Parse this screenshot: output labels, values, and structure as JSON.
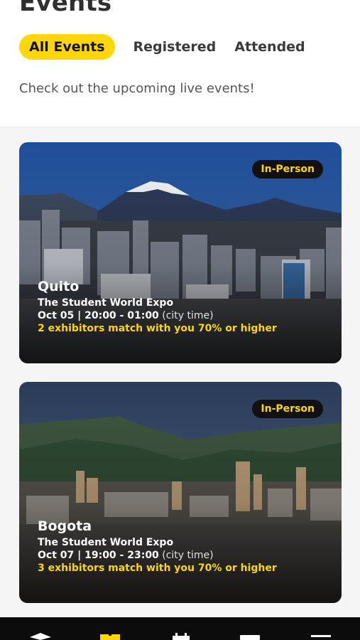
{
  "header": {
    "title": "Events",
    "tabs": [
      {
        "label": "All Events",
        "active": true
      },
      {
        "label": "Registered",
        "active": false
      },
      {
        "label": "Attended",
        "active": false
      }
    ],
    "subtitle": "Check out the upcoming live events!"
  },
  "events": [
    {
      "badge": "In-Person",
      "city": "Quito",
      "name": "The Student World Expo",
      "datetime": "Oct 05 | 20:00 - 01:00",
      "timezone_note": "(city time)",
      "match": "2 exhibitors match with you 70% or higher"
    },
    {
      "badge": "In-Person",
      "city": "Bogota",
      "name": "The Student World Expo",
      "datetime": "Oct 07 | 19:00 - 23:00",
      "timezone_note": "(city time)",
      "match": "3 exhibitors match with you 70% or higher"
    }
  ],
  "bottom_nav": {
    "icons": [
      "graduation-cap-icon",
      "calendar-event-icon",
      "calendar-icon",
      "chat-icon",
      "menu-icon"
    ]
  },
  "colors": {
    "accent": "#ffd60a",
    "badge_bg": "#111111",
    "nav_bg": "#0c0c0c",
    "content_bg": "#f5f5f5"
  }
}
